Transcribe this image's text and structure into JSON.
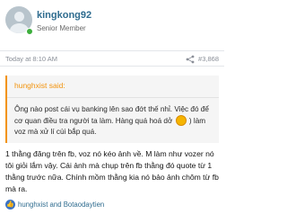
{
  "author": {
    "username": "kingkong92",
    "user_title": "Senior Member"
  },
  "meta": {
    "time": "Today at 8:10 AM",
    "post_number": "#3,868"
  },
  "quote": {
    "header": "hunghxist said:",
    "text_before_smiley": "Ông nào post cái vụ banking lên sao đớt thế nhỉ. Việc đó để cơ quan điều tra người ta làm. Hàng quá hoá dở",
    "text_after_smiley": ") làm voz mà xử lí cùi bắp quá."
  },
  "message": {
    "text": "1 thằng đăng trên fb, voz nó kéo ảnh về. M làm như vozer nó tôi giỏi lắm vậy. Cái ảnh mà chụp trên fb thằng đó quote từ 1 thằng trước nữa. Chính mồm thằng kia nó bảo ảnh chôm từ fb mà ra."
  },
  "reactions": {
    "icon": "like-icon",
    "text": "hunghxist and Botaodaytien"
  },
  "colors": {
    "username": "#2f6c8f",
    "quote_accent": "#f2930d",
    "online": "#3cae3c",
    "like": "#3b73c4"
  }
}
